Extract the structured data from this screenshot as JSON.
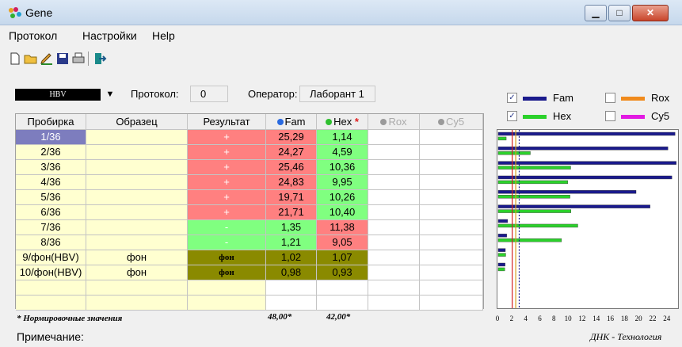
{
  "window": {
    "title": "Gene",
    "min": "▁",
    "max": "□",
    "close": "✕"
  },
  "menu": [
    "Протокол",
    "Настройки",
    "Help"
  ],
  "toolbar_icons": [
    "new-file-icon",
    "open-folder-icon",
    "edit-icon",
    "save-icon",
    "print-icon",
    "export-icon"
  ],
  "header": {
    "assay": "HBV",
    "protocol_label": "Протокол:",
    "protocol_value": "0",
    "operator_label": "Оператор:",
    "operator_value": "Лаборант 1"
  },
  "table": {
    "columns": [
      "Пробирка",
      "Образец",
      "Результат",
      "Fam",
      "Hex",
      "Rox",
      "Cy5"
    ],
    "hex_marker": "*",
    "rows": [
      {
        "tube": "1/36",
        "sample": "",
        "result": "+",
        "fam": "25,29",
        "hex": "1,14",
        "state": "pos"
      },
      {
        "tube": "2/36",
        "sample": "",
        "result": "+",
        "fam": "24,27",
        "hex": "4,59",
        "state": "pos"
      },
      {
        "tube": "3/36",
        "sample": "",
        "result": "+",
        "fam": "25,46",
        "hex": "10,36",
        "state": "pos"
      },
      {
        "tube": "4/36",
        "sample": "",
        "result": "+",
        "fam": "24,83",
        "hex": "9,95",
        "state": "pos"
      },
      {
        "tube": "5/36",
        "sample": "",
        "result": "+",
        "fam": "19,71",
        "hex": "10,26",
        "state": "pos"
      },
      {
        "tube": "6/36",
        "sample": "",
        "result": "+",
        "fam": "21,71",
        "hex": "10,40",
        "state": "pos"
      },
      {
        "tube": "7/36",
        "sample": "",
        "result": "-",
        "fam": "1,35",
        "hex": "11,38",
        "state": "neg"
      },
      {
        "tube": "8/36",
        "sample": "",
        "result": "-",
        "fam": "1,21",
        "hex": "9,05",
        "state": "neg"
      },
      {
        "tube": "9/фон(HBV)",
        "sample": "фон",
        "result": "фон",
        "fam": "1,02",
        "hex": "1,07",
        "state": "bg"
      },
      {
        "tube": "10/фон(HBV)",
        "sample": "фон",
        "result": "фон",
        "fam": "0,98",
        "hex": "0,93",
        "state": "bg"
      }
    ],
    "footnote": "* Нормировочные значения",
    "norm_fam": "48,00*",
    "norm_hex": "42,00*"
  },
  "note_label": "Примечание:",
  "legend": [
    {
      "name": "Fam",
      "checked": true,
      "color": "#1a1a8c"
    },
    {
      "name": "Rox",
      "checked": false,
      "color": "#f08a1c"
    },
    {
      "name": "Hex",
      "checked": true,
      "color": "#2bd12b"
    },
    {
      "name": "Cy5",
      "checked": false,
      "color": "#e21be2"
    }
  ],
  "check_mark": "✓",
  "brand": "ДНК - Технология",
  "chart_data": {
    "type": "bar",
    "orientation": "horizontal",
    "categories": [
      "1/36",
      "2/36",
      "3/36",
      "4/36",
      "5/36",
      "6/36",
      "7/36",
      "8/36",
      "9/фон(HBV)",
      "10/фон(HBV)"
    ],
    "series": [
      {
        "name": "Fam",
        "color": "#1a1a8c",
        "values": [
          25.29,
          24.27,
          25.46,
          24.83,
          19.71,
          21.71,
          1.35,
          1.21,
          1.02,
          0.98
        ]
      },
      {
        "name": "Hex",
        "color": "#2bd12b",
        "values": [
          1.14,
          4.59,
          10.36,
          9.95,
          10.26,
          10.4,
          11.38,
          9.05,
          1.07,
          0.93
        ]
      }
    ],
    "xlim": [
      0,
      25.6
    ],
    "xticks": [
      "0",
      "2",
      "4",
      "6",
      "8",
      "10",
      "12",
      "14",
      "16",
      "18",
      "20",
      "22",
      "24"
    ],
    "threshold_lines": [
      {
        "value": 2,
        "color": "#d22020",
        "style": "solid"
      },
      {
        "value": 2.5,
        "color": "#d6a020",
        "style": "solid"
      },
      {
        "value": 3,
        "color": "#1a1a8c",
        "style": "dashed"
      }
    ]
  }
}
